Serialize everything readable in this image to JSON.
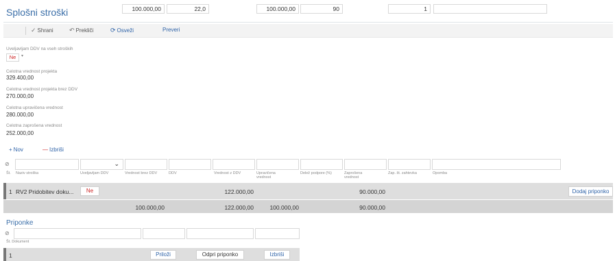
{
  "page": {
    "title": "Splošni stroški"
  },
  "toolbar": {
    "save": "Shrani",
    "cancel": "Prekliči",
    "refresh": "Osveži",
    "check": "Preveri"
  },
  "form": {
    "vat_label": "Uveljavljam DDV na vseh stroških",
    "vat_value": "Ne",
    "f1_label": "Celotna vrednost projekta",
    "f1_value": "329.400,00",
    "f2_label": "Celotna vrednost projekta brez DDV",
    "f2_value": "270.000,00",
    "f3_label": "Celotna upravičena vrednost",
    "f3_value": "280.000,00",
    "f4_label": "Celotna zaprošena vrednost",
    "f4_value": "252.000,00"
  },
  "actions": {
    "new": "Nov",
    "delete": "Izbriši"
  },
  "table": {
    "headers": {
      "num": "Št.",
      "name": "Naziv stroška",
      "vat": "Uveljavljam DDV",
      "no_vat": "Vrednost brez DDV",
      "ddv": "DDV",
      "with_vat": "Vrednost z DDV",
      "eligible": "Upravičena vrednost",
      "support": "Delež podpore (%)",
      "requested": "Zaprošena vrednost",
      "req_no": "Zap. št. zahtevka",
      "note": "Opomba"
    },
    "row": {
      "num": "1",
      "name": "RV2 Pridobitev doku...",
      "vat": "Ne",
      "no_vat": "100.000,00",
      "ddv": "22,0",
      "with_vat": "122.000,00",
      "eligible": "100.000,00",
      "support": "90",
      "requested": "90.000,00",
      "req_no": "1",
      "note": "",
      "attach_btn": "Dodaj priponko"
    },
    "totals": {
      "no_vat": "100.000,00",
      "with_vat": "122.000,00",
      "eligible": "100.000,00",
      "requested": "90.000,00"
    }
  },
  "attachments": {
    "title": "Priponke",
    "headers": {
      "num": "Št.",
      "doc": "Dokument"
    },
    "row": {
      "num": "1",
      "attach": "Priloži",
      "open": "Odpri priponko",
      "delete": "Izbriši"
    }
  }
}
